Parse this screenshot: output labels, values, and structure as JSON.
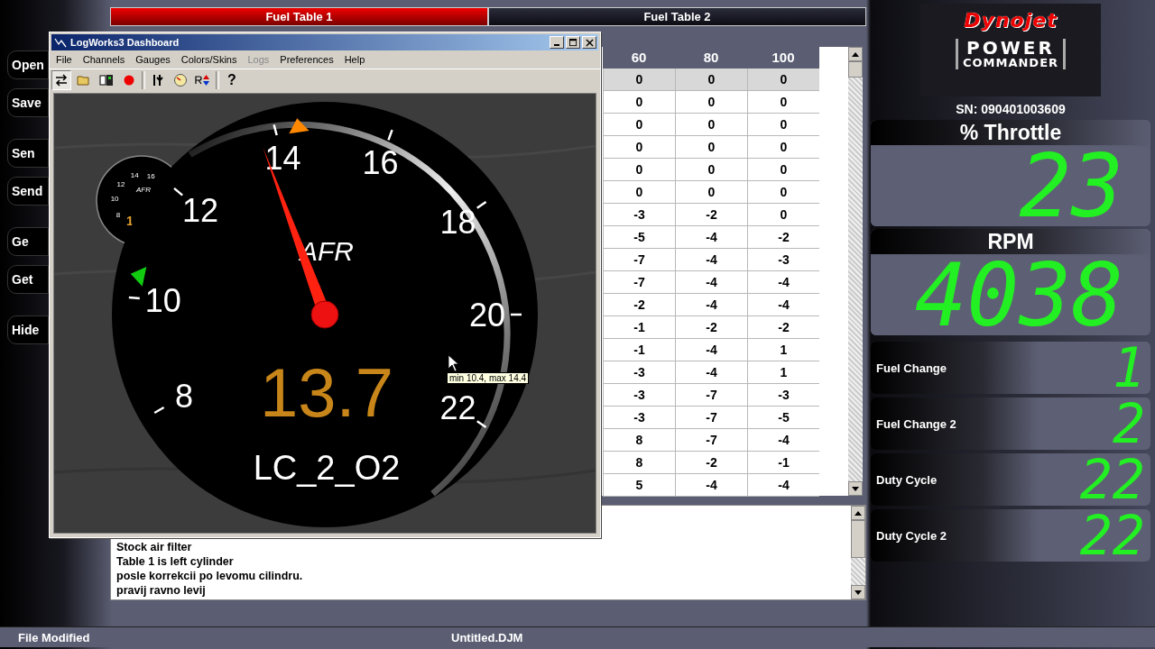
{
  "side_buttons": [
    [
      "Open",
      "Save"
    ],
    [
      "Sen",
      "Send"
    ],
    [
      "Ge",
      "Get"
    ],
    [
      "Hide"
    ]
  ],
  "tabs": [
    {
      "label": "Fuel Table 1",
      "selected": true
    },
    {
      "label": "Fuel Table 2",
      "selected": false
    }
  ],
  "table": {
    "columns": [
      "60",
      "80",
      "100"
    ],
    "rows": [
      {
        "cells": [
          "0",
          "0",
          "0"
        ],
        "selected": true
      },
      {
        "cells": [
          "0",
          "0",
          "0"
        ],
        "selected": false
      },
      {
        "cells": [
          "0",
          "0",
          "0"
        ],
        "selected": false
      },
      {
        "cells": [
          "0",
          "0",
          "0"
        ],
        "selected": false
      },
      {
        "cells": [
          "0",
          "0",
          "0"
        ],
        "selected": false
      },
      {
        "cells": [
          "0",
          "0",
          "0"
        ],
        "selected": false
      },
      {
        "cells": [
          "-3",
          "-2",
          "0"
        ],
        "selected": false
      },
      {
        "cells": [
          "-5",
          "-4",
          "-2"
        ],
        "selected": false
      },
      {
        "cells": [
          "-7",
          "-4",
          "-3"
        ],
        "selected": false
      },
      {
        "cells": [
          "-7",
          "-4",
          "-4"
        ],
        "selected": false
      },
      {
        "cells": [
          "-2",
          "-4",
          "-4"
        ],
        "selected": false
      },
      {
        "cells": [
          "-1",
          "-2",
          "-2"
        ],
        "selected": false
      },
      {
        "cells": [
          "-1",
          "-4",
          "1"
        ],
        "selected": false
      },
      {
        "cells": [
          "-3",
          "-4",
          "1"
        ],
        "selected": false
      },
      {
        "cells": [
          "-3",
          "-7",
          "-3"
        ],
        "selected": false
      },
      {
        "cells": [
          "-3",
          "-7",
          "-5"
        ],
        "selected": false
      },
      {
        "cells": [
          "8",
          "-7",
          "-4"
        ],
        "selected": false
      },
      {
        "cells": [
          "8",
          "-2",
          "-1"
        ],
        "selected": false
      },
      {
        "cells": [
          "5",
          "-4",
          "-4"
        ],
        "selected": false
      }
    ]
  },
  "notes": [
    "Stock air filter",
    "Table 1 is left cylinder",
    "posle korrekcii po levomu cilindru.",
    "pravij ravno levij"
  ],
  "status_bar": {
    "left": "File Modified",
    "center": "Untitled.DJM"
  },
  "dashboard": {
    "title": "LogWorks3 Dashboard",
    "menu": [
      {
        "label": "File",
        "disabled": false
      },
      {
        "label": "Channels",
        "disabled": false
      },
      {
        "label": "Gauges",
        "disabled": false
      },
      {
        "label": "Colors/Skins",
        "disabled": false
      },
      {
        "label": "Logs",
        "disabled": true
      },
      {
        "label": "Preferences",
        "disabled": false
      },
      {
        "label": "Help",
        "disabled": false
      }
    ],
    "help_button": "?",
    "small_gauge": {
      "labels": [
        "8",
        "10",
        "12",
        "14",
        "16"
      ],
      "unit": "AFR",
      "value": "1"
    },
    "gauge": {
      "labels": [
        "8",
        "10",
        "12",
        "14",
        "16",
        "18",
        "20",
        "22"
      ],
      "unit": "AFR",
      "value": "13.7",
      "channel": "LC_2_O2",
      "min_marker": true,
      "max_marker": true
    },
    "tooltip": "min 10.4, max 14.4"
  },
  "logo": {
    "brand": "Dynojet",
    "line1": "POWER",
    "line2": "COMMANDER"
  },
  "serial": "SN: 090401003609",
  "big_displays": [
    {
      "label": "% Throttle",
      "value": "23"
    },
    {
      "label": "RPM",
      "value": "4038"
    }
  ],
  "small_displays": [
    {
      "label": "Fuel Change",
      "value": "1"
    },
    {
      "label": "Fuel Change 2",
      "value": "2"
    },
    {
      "label": "Duty Cycle",
      "value": "22"
    },
    {
      "label": "Duty Cycle 2",
      "value": "22"
    }
  ]
}
